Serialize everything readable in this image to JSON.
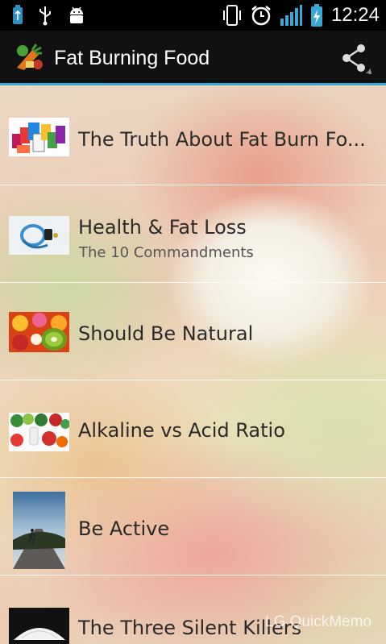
{
  "status_bar": {
    "time": "12:24",
    "icons": [
      "usb-debug-icon",
      "usb-icon",
      "android-icon",
      "vibrate-icon",
      "alarm-icon",
      "signal-icon",
      "battery-charging-icon"
    ]
  },
  "action_bar": {
    "title": "Fat Burning Food",
    "share_icon": "share-icon",
    "accent_color": "#3aa7d6"
  },
  "list": [
    {
      "title": "The Truth About Fat Burn Fo...",
      "subtitle": ""
    },
    {
      "title": "Health & Fat Loss",
      "subtitle": "The 10 Commandments"
    },
    {
      "title": "Should Be Natural",
      "subtitle": ""
    },
    {
      "title": "Alkaline vs Acid Ratio",
      "subtitle": ""
    },
    {
      "title": "Be Active",
      "subtitle": ""
    },
    {
      "title": "The Three Silent Killers",
      "subtitle": ""
    }
  ],
  "watermark": "LG QuickMemo"
}
